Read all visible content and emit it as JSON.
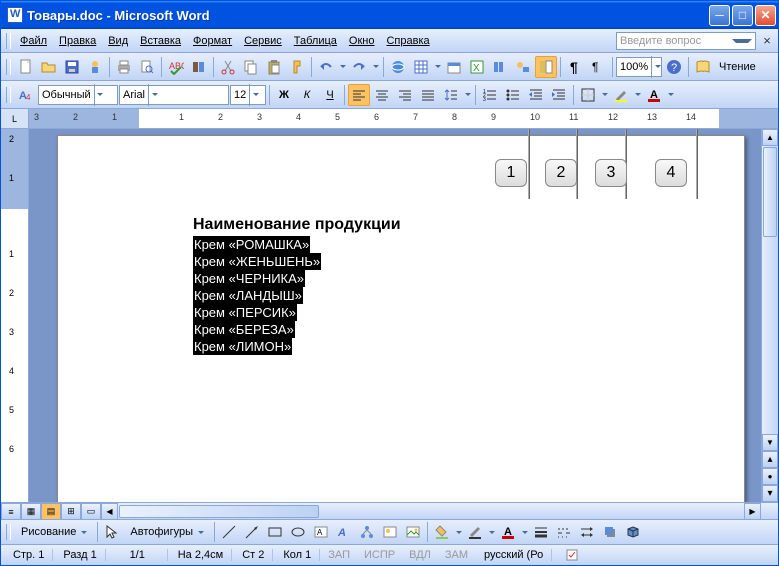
{
  "title": "Товары.doc - Microsoft Word",
  "menus": [
    "Файл",
    "Правка",
    "Вид",
    "Вставка",
    "Формат",
    "Сервис",
    "Таблица",
    "Окно",
    "Справка"
  ],
  "helpPlaceholder": "Введите вопрос",
  "style": "Обычный",
  "font": "Arial",
  "fontSize": "12",
  "zoom": "100%",
  "reading": "Чтение",
  "drawMenu": "Рисование",
  "autoshapes": "Автофигуры",
  "doc": {
    "heading": "Наименование продукции",
    "lines": [
      "Крем  «РОМАШКА»",
      "Крем  «ЖЕНЬШЕНЬ»",
      "Крем  «ЧЕРНИКА»",
      "Крем  «ЛАНДЫШ»",
      "Крем  «ПЕРСИК»",
      "Крем  «БЕРЕЗА»",
      "Крем  «ЛИМОН»"
    ]
  },
  "callouts": [
    "1",
    "2",
    "3",
    "4"
  ],
  "status": {
    "page": "Стр. 1",
    "section": "Разд 1",
    "pages": "1/1",
    "at": "На 2,4см",
    "line": "Ст 2",
    "col": "Кол 1",
    "modes": [
      "ЗАП",
      "ИСПР",
      "ВДЛ",
      "ЗАМ"
    ],
    "lang": "русский (Ро"
  },
  "rulerLabel": "L",
  "hticks": [
    "3",
    "2",
    "1",
    "1",
    "2",
    "3",
    "4",
    "5",
    "6",
    "7",
    "8",
    "9",
    "10",
    "11",
    "12",
    "13",
    "14"
  ],
  "vticks": [
    "2",
    "1",
    "1",
    "2",
    "3",
    "4",
    "5",
    "6"
  ]
}
